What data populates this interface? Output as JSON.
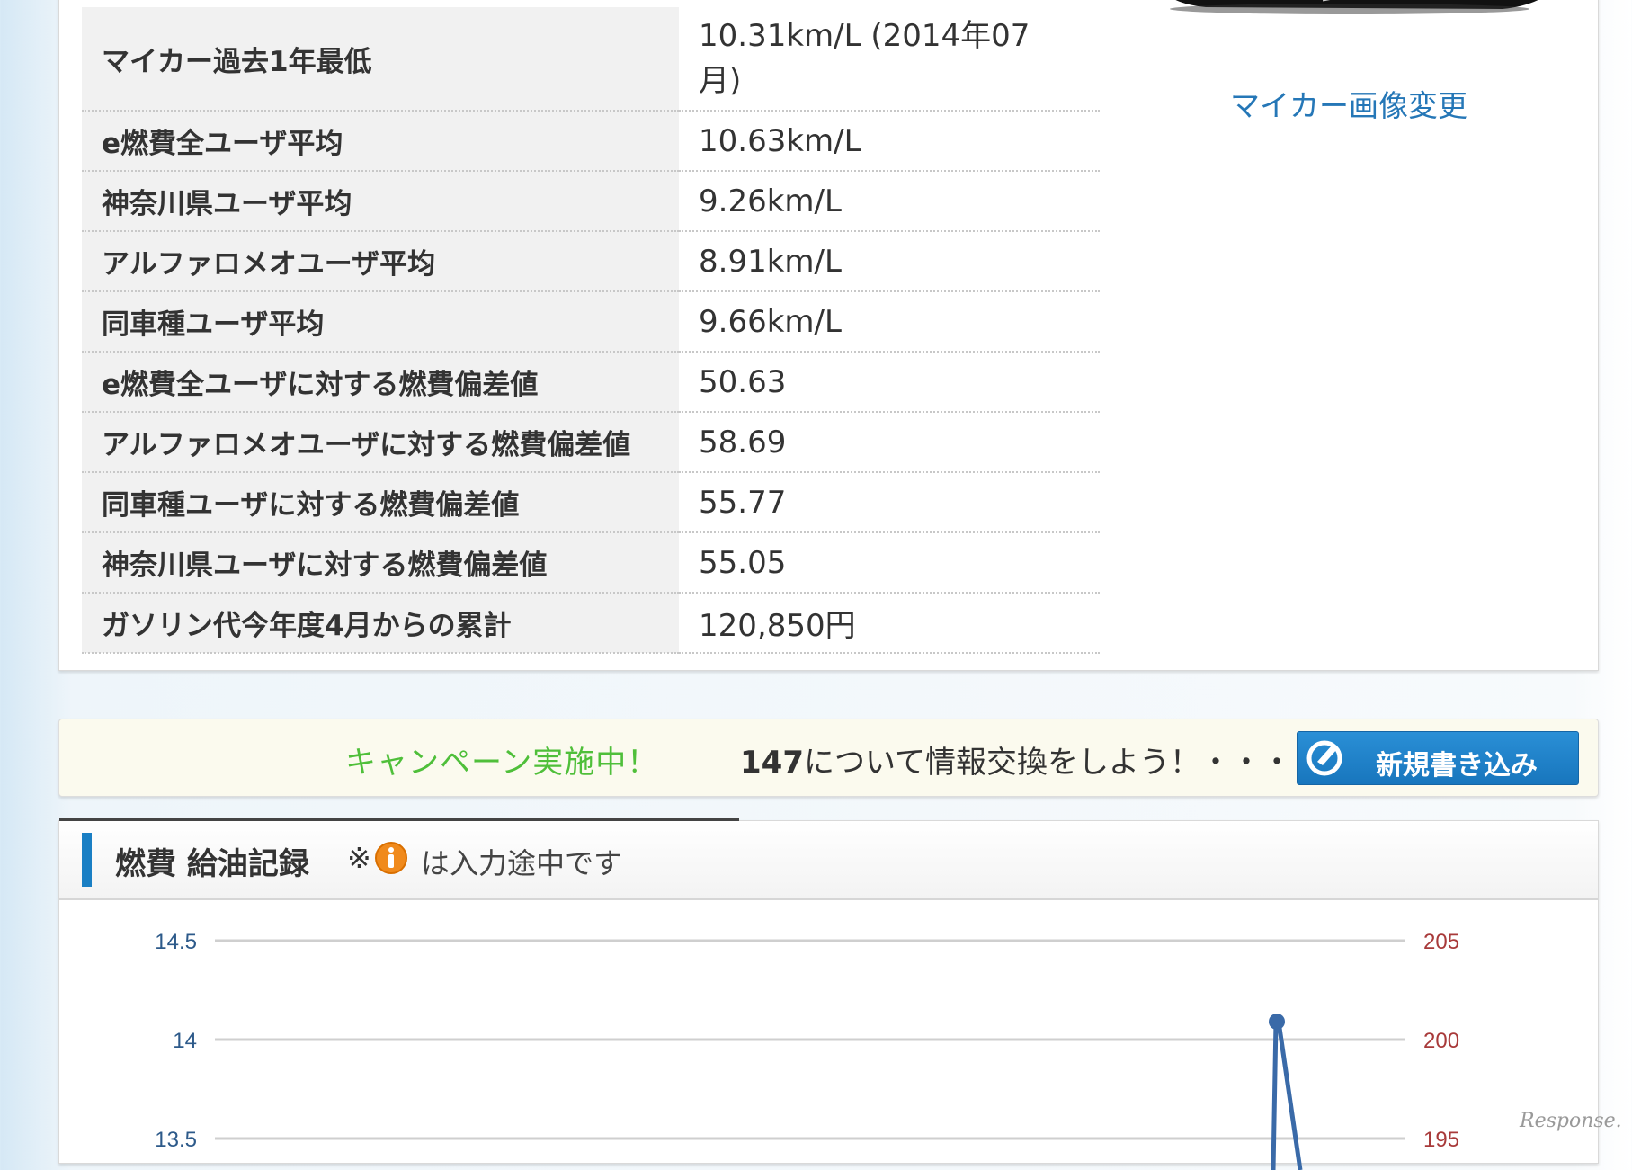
{
  "stats": {
    "rows": [
      {
        "label": "マイカー過去1年最低",
        "value": "10.31km/L (2014年07月)"
      },
      {
        "label": "e燃費全ユーザ平均",
        "value": "10.63km/L"
      },
      {
        "label": "神奈川県ユーザ平均",
        "value": "9.26km/L"
      },
      {
        "label": "アルファロメオユーザ平均",
        "value": "8.91km/L"
      },
      {
        "label": "同車種ユーザ平均",
        "value": "9.66km/L"
      },
      {
        "label": "e燃費全ユーザに対する燃費偏差値",
        "value": "50.63"
      },
      {
        "label": "アルファロメオユーザに対する燃費偏差値",
        "value": "58.69"
      },
      {
        "label": "同車種ユーザに対する燃費偏差値",
        "value": "55.77"
      },
      {
        "label": "神奈川県ユーザに対する燃費偏差値",
        "value": "55.05"
      },
      {
        "label": "ガソリン代今年度4月からの累計",
        "value": "120,850円"
      }
    ],
    "change_image_link": "マイカー画像変更"
  },
  "campaign": {
    "campaign_text": "キャンペーン実施中！",
    "model_name": "147",
    "info_text": "について情報交換をしよう！・・・",
    "new_post_button": "新規書き込み"
  },
  "log": {
    "title": "燃費 給油記録",
    "note_mark": "※",
    "note_text": "は入力途中です",
    "info_icon": "info-icon"
  },
  "chart_data": {
    "type": "line",
    "left_axis": {
      "ticks": [
        "14.5",
        "14",
        "13.5"
      ],
      "ylim_visible": [
        13.5,
        14.5
      ]
    },
    "right_axis": {
      "ticks": [
        "205",
        "200",
        "195"
      ],
      "ylim_visible": [
        195,
        205
      ]
    },
    "series": [
      {
        "values": [
          14.0
        ],
        "point_index_note": "peak near right side"
      }
    ],
    "grid": true
  },
  "watermark": "Response."
}
